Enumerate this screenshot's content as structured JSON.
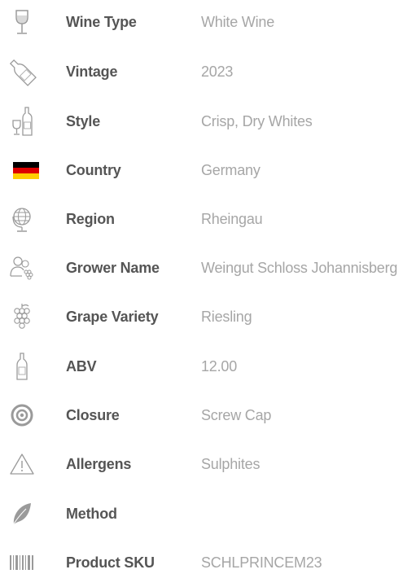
{
  "rows": [
    {
      "icon": "wine-glass-icon",
      "label": "Wine Type",
      "value": "White Wine"
    },
    {
      "icon": "wine-bottle-icon",
      "label": "Vintage",
      "value": "2023"
    },
    {
      "icon": "bottle-and-glass-icon",
      "label": "Style",
      "value": "Crisp, Dry Whites"
    },
    {
      "icon": "germany-flag-icon",
      "label": "Country",
      "value": "Germany"
    },
    {
      "icon": "globe-icon",
      "label": "Region",
      "value": "Rheingau"
    },
    {
      "icon": "grower-icon",
      "label": "Grower Name",
      "value": "Weingut Schloss Johannisberg"
    },
    {
      "icon": "grapes-icon",
      "label": "Grape Variety",
      "value": "Riesling"
    },
    {
      "icon": "bottle-icon",
      "label": "ABV",
      "value": "12.00"
    },
    {
      "icon": "closure-target-icon",
      "label": "Closure",
      "value": "Screw Cap"
    },
    {
      "icon": "warning-icon",
      "label": "Allergens",
      "value": "Sulphites"
    },
    {
      "icon": "leaf-icon",
      "label": "Method",
      "value": ""
    },
    {
      "icon": "barcode-icon",
      "label": "Product SKU",
      "value": "SCHLPRINCEM23"
    }
  ],
  "colors": {
    "label": "#555555",
    "value": "#a6a6a6",
    "icon": "#9a9a9a",
    "flag_black": "#000000",
    "flag_red": "#dd0000",
    "flag_gold": "#ffce00"
  }
}
